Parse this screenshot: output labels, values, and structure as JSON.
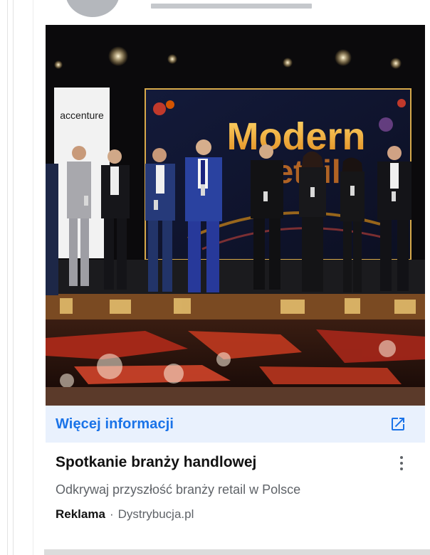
{
  "ad": {
    "image": {
      "alt": "Modern Retail award ceremony stage",
      "sign_left": "accenture",
      "screen_text_line1": "Modern",
      "screen_text_line2": "Retail"
    },
    "more_info_label": "Więcej informacji",
    "title": "Spotkanie branży handlowej",
    "description": "Odkrywaj przyszłość branży retail w Polsce",
    "ad_label": "Reklama",
    "separator": "·",
    "advertiser": "Dystrybucja.pl",
    "colors": {
      "link_blue": "#1a73e8",
      "more_bar_bg": "#e9f1fd",
      "title": "#111111",
      "secondary": "#5f6368"
    }
  },
  "icons": {
    "open_external": "open-in-new-icon",
    "menu": "more-vert-icon"
  }
}
